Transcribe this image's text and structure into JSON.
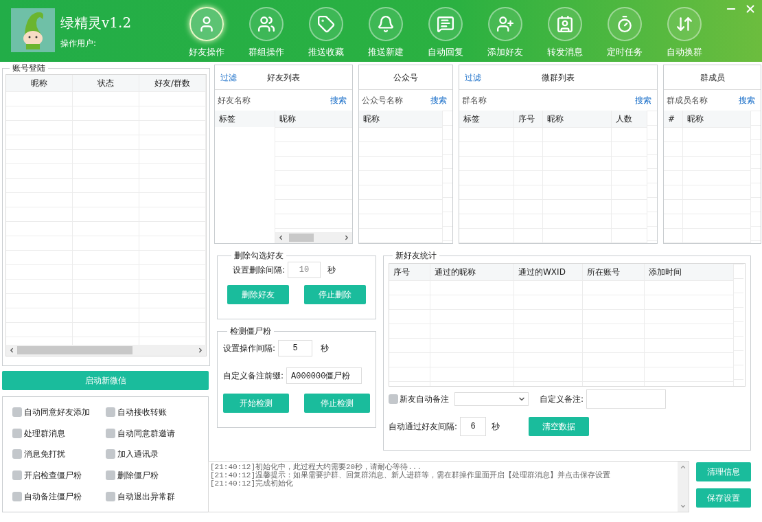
{
  "app": {
    "title": "绿精灵v1.2",
    "user_label": "操作用户:"
  },
  "nav": [
    {
      "label": "好友操作",
      "kind": "user",
      "selected": true
    },
    {
      "label": "群组操作",
      "kind": "users",
      "selected": false
    },
    {
      "label": "推送收藏",
      "kind": "tag",
      "selected": false
    },
    {
      "label": "推送新建",
      "kind": "bell",
      "selected": false
    },
    {
      "label": "自动回复",
      "kind": "chat",
      "selected": false
    },
    {
      "label": "添加好友",
      "kind": "user-plus",
      "selected": false
    },
    {
      "label": "转发消息",
      "kind": "contact",
      "selected": false
    },
    {
      "label": "定时任务",
      "kind": "timer",
      "selected": false
    },
    {
      "label": "自动换群",
      "kind": "swap",
      "selected": false
    }
  ],
  "accounts": {
    "title": "账号登陆",
    "columns": [
      "昵称",
      "状态",
      "好友/群数"
    ]
  },
  "launch_button": "启动新微信",
  "options": [
    {
      "label": "自动同意好友添加",
      "checked": false
    },
    {
      "label": "自动接收转账",
      "checked": false
    },
    {
      "label": "处理群消息",
      "checked": false
    },
    {
      "label": "自动同意群邀请",
      "checked": false
    },
    {
      "label": "消息免打扰",
      "checked": false
    },
    {
      "label": "加入通讯录",
      "checked": false
    },
    {
      "label": "开启检查僵尸粉",
      "checked": false
    },
    {
      "label": "删除僵尸粉",
      "checked": false
    },
    {
      "label": "自动备注僵尸粉",
      "checked": false
    },
    {
      "label": "自动退出异常群",
      "checked": false
    }
  ],
  "friend_list": {
    "filter": "过滤",
    "title": "好友列表",
    "placeholder": "好友名称",
    "search": "搜索",
    "columns": [
      "标签",
      "昵称"
    ]
  },
  "official_accounts": {
    "title": "公众号",
    "placeholder": "公众号名称",
    "search": "搜索",
    "columns": [
      "昵称"
    ]
  },
  "group_list": {
    "filter": "过滤",
    "title": "微群列表",
    "placeholder": "群名称",
    "search": "搜索",
    "columns": [
      "标签",
      "序号",
      "昵称",
      "人数"
    ]
  },
  "group_members": {
    "title": "群成员",
    "placeholder": "群成员名称",
    "search": "搜索",
    "columns": [
      "#",
      "昵称"
    ]
  },
  "delete_friends": {
    "title": "删除勾选好友",
    "interval_label": "设置删除间隔:",
    "interval": "10",
    "unit": "秒",
    "buttons": [
      "删除好友",
      "停止删除"
    ]
  },
  "zombie_check": {
    "title": "检测僵尸粉",
    "interval_label": "设置操作间隔:",
    "interval": "5",
    "unit": "秒",
    "prefix_label": "自定义备注前缀:",
    "prefix": "A000000僵尸粉",
    "buttons": [
      "开始检测",
      "停止检测"
    ]
  },
  "new_friend_stats": {
    "title": "新好友统计",
    "columns": [
      "序号",
      "通过的昵称",
      "通过的WXID",
      "所在账号",
      "添加时间"
    ],
    "auto_remark": {
      "label": "新友自动备注",
      "checked": false
    },
    "remark_label": "自定义备注:",
    "interval_label": "自动通过好友间隔:",
    "interval": "6",
    "unit": "秒",
    "clear_button": "清空数据"
  },
  "log": {
    "lines": [
      "[21:40:12]初始化中，此过程大约需要20秒，请耐心等待...",
      "[21:40:12]温馨提示：如果需要护群、回复群消息、新人进群等，需在群操作里面开启【处理群消息】并点击保存设置",
      "[21:40:12]完成初始化"
    ]
  },
  "log_buttons": [
    "清理信息",
    "保存设置"
  ]
}
